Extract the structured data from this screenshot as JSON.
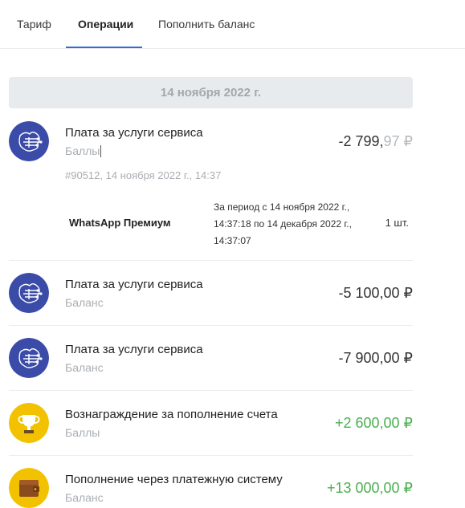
{
  "tabs": [
    {
      "label": "Тариф"
    },
    {
      "label": "Операции"
    },
    {
      "label": "Пополнить баланс"
    }
  ],
  "active_tab": "Операции",
  "date_header": "14 ноября 2022 г.",
  "currency": "₽",
  "colors": {
    "accent": "#2f6fd1",
    "positive": "#4caf50",
    "service_icon": "#3b4ba8",
    "reward_icon": "#f2c200"
  },
  "operations": [
    {
      "icon": "circuit-icon",
      "title": "Плата за услуги сервиса",
      "account": "Баллы",
      "amount_int": "-2 799,",
      "amount_frac": "97",
      "currency": "₽",
      "meta": "#90512, 14 ноября 2022 г., 14:37",
      "detail": {
        "name": "WhatsApp Премиум",
        "period": "За период с 14 ноября 2022 г., 14:37:18 по 14 декабря 2022 г., 14:37:07",
        "qty": "1 шт."
      }
    },
    {
      "icon": "circuit-icon",
      "title": "Плата за услуги сервиса",
      "account": "Баланс",
      "amount": "-5 100,00 ₽"
    },
    {
      "icon": "circuit-icon",
      "title": "Плата за услуги сервиса",
      "account": "Баланс",
      "amount": "-7 900,00 ₽"
    },
    {
      "icon": "trophy-icon",
      "title": "Вознаграждение за пополнение счета",
      "account": "Баллы",
      "amount": "+2 600,00 ₽"
    },
    {
      "icon": "wallet-icon",
      "title": "Пополнение через платежную систему",
      "account": "Баланс",
      "amount": "+13 000,00 ₽"
    }
  ]
}
